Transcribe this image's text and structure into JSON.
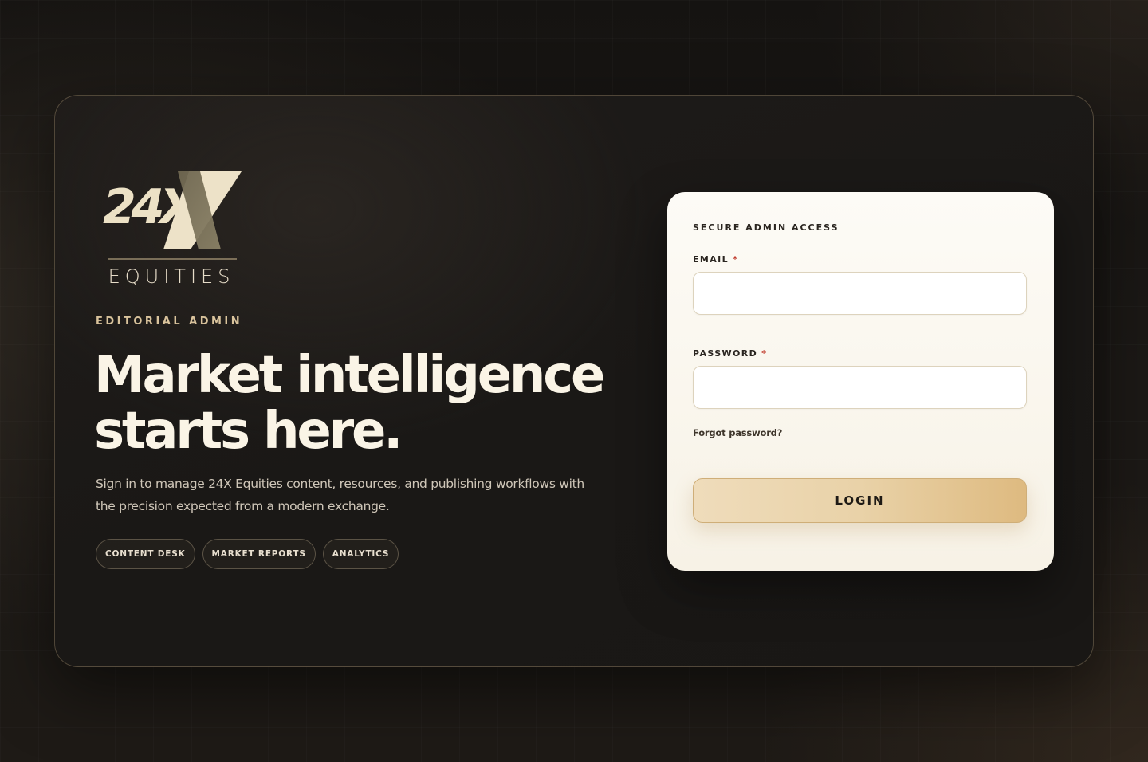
{
  "brand": {
    "logo_mark": "24X",
    "logo_sub": "EQUITIES",
    "colors": {
      "gold": "#d9c39c",
      "cream": "#faf4e6",
      "accent_button": "#e9d2a8",
      "required": "#c0392b"
    }
  },
  "hero": {
    "kicker": "EDITORIAL ADMIN",
    "headline_line1": "Market intelligence",
    "headline_line2": "starts here.",
    "subcopy": "Sign in to manage 24X Equities content, resources, and publishing workflows with the precision expected from a modern exchange.",
    "chips": [
      "CONTENT DESK",
      "MARKET REPORTS",
      "ANALYTICS"
    ]
  },
  "login": {
    "title": "SECURE ADMIN ACCESS",
    "email_label": "EMAIL",
    "email_value": "",
    "password_label": "PASSWORD",
    "password_value": "",
    "required_mark": "*",
    "forgot": "Forgot password?",
    "submit": "LOGIN"
  }
}
